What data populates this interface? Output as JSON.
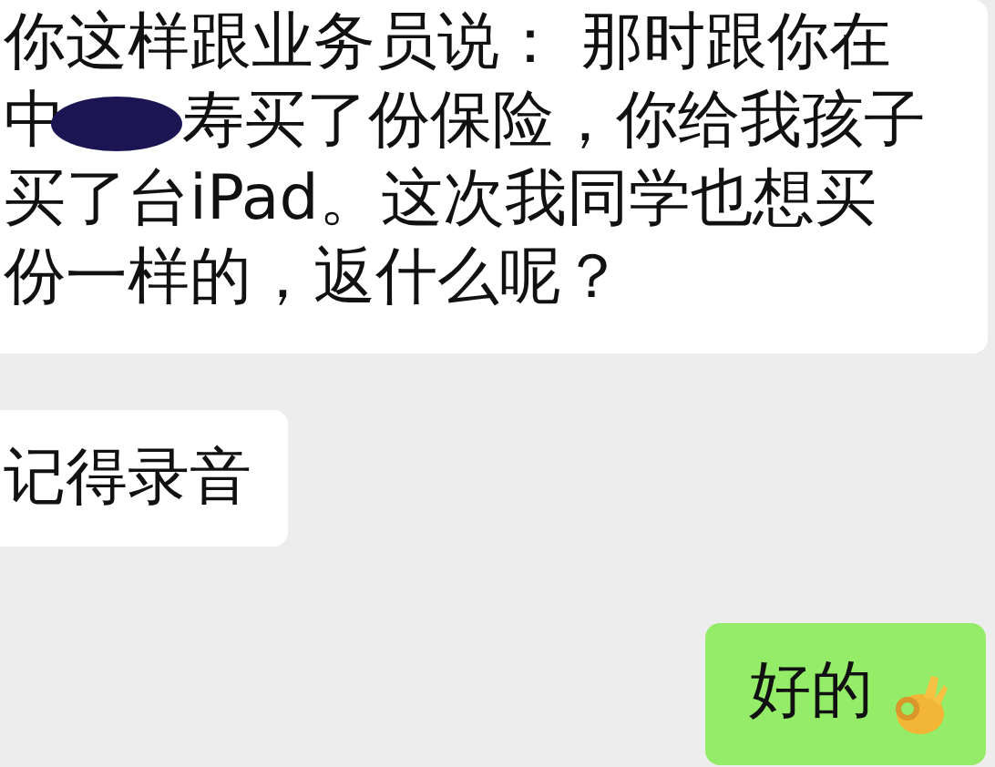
{
  "messages": [
    {
      "kind": "incoming",
      "text_before": "你这样跟业务员说： 那时跟你在中",
      "redacted": true,
      "text_after": "寿买了份保险，你给我孩子买了台iPad。这次我同学也想买份一样的，返什么呢？"
    },
    {
      "kind": "incoming",
      "text_before": "记得录音"
    },
    {
      "kind": "outgoing",
      "text_before": "好的",
      "has_emoji": true
    }
  ]
}
